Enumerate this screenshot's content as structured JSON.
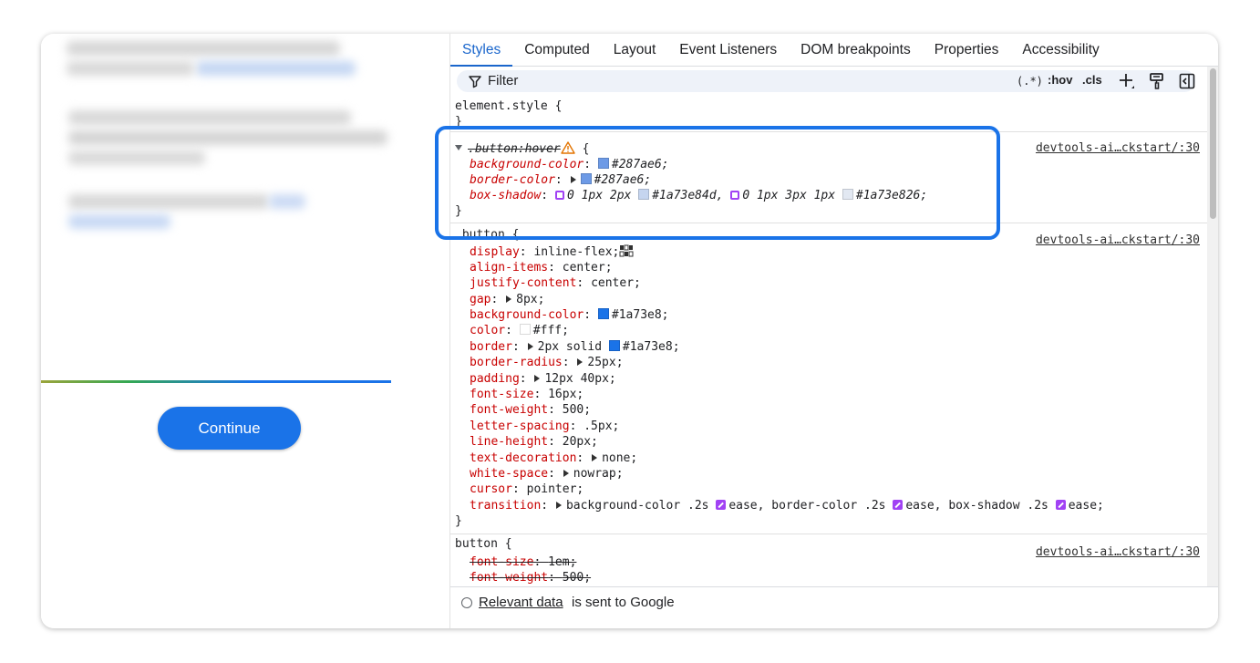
{
  "tabs": [
    {
      "label": "Styles",
      "active": true
    },
    {
      "label": "Computed"
    },
    {
      "label": "Layout"
    },
    {
      "label": "Event Listeners"
    },
    {
      "label": "DOM breakpoints"
    },
    {
      "label": "Properties"
    },
    {
      "label": "Accessibility"
    }
  ],
  "filter": {
    "label": "Filter",
    "regex": "(.*)",
    "hov": ":hov",
    "cls": ".cls"
  },
  "left_panel": {
    "continue_label": "Continue"
  },
  "rules": {
    "element_style": {
      "selector": "element.style",
      "open": "{",
      "close": "}"
    },
    "hover": {
      "selector": ".button:hover",
      "open": "{",
      "close": "}",
      "source": "devtools-ai…ckstart/:30",
      "bg_prop": "background-color",
      "bg_val": "#287ae6;",
      "border_prop": "border-color",
      "border_val": "#287ae6;",
      "shadow_prop": "box-shadow",
      "shadow_1": "0 1px 2px",
      "shadow_1_color": "#1a73e84d,",
      "shadow_2": "0 1px 3px 1px",
      "shadow_2_color": "#1a73e826;"
    },
    "button": {
      "selector": ".button",
      "open": "{",
      "close": "}",
      "source": "devtools-ai…ckstart/:30",
      "props": [
        {
          "name": "display",
          "value": "inline-flex;"
        },
        {
          "name": "align-items",
          "value": "center;"
        },
        {
          "name": "justify-content",
          "value": "center;"
        },
        {
          "name": "gap",
          "value": "8px;"
        },
        {
          "name": "background-color",
          "value": "#1a73e8;"
        },
        {
          "name": "color",
          "value": "#fff;"
        },
        {
          "name": "border",
          "value": "2px solid",
          "value2": "#1a73e8;"
        },
        {
          "name": "border-radius",
          "value": "25px;"
        },
        {
          "name": "padding",
          "value": "12px 40px;"
        },
        {
          "name": "font-size",
          "value": "16px;"
        },
        {
          "name": "font-weight",
          "value": "500;"
        },
        {
          "name": "letter-spacing",
          "value": ".5px;"
        },
        {
          "name": "line-height",
          "value": "20px;"
        },
        {
          "name": "text-decoration",
          "value": "none;"
        },
        {
          "name": "white-space",
          "value": "nowrap;"
        },
        {
          "name": "cursor",
          "value": "pointer;"
        },
        {
          "name": "transition",
          "value_a": "background-color .2s",
          "ease": "ease,",
          "value_b": "border-color .2s",
          "value_c": "box-shadow .2s",
          "ease_last": "ease;"
        }
      ]
    },
    "button_el": {
      "selector": "button",
      "open": "{",
      "source": "devtools-ai…ckstart/:30",
      "props": [
        {
          "name": "font-size",
          "value": "1em;"
        },
        {
          "name": "font-weight",
          "value": "500;"
        }
      ]
    }
  },
  "footer": {
    "link": "Relevant data",
    "text": "is sent to Google"
  },
  "colors": {
    "accent": "#1a73e8",
    "hover_bg": "#287ae6",
    "white": "#fff"
  }
}
